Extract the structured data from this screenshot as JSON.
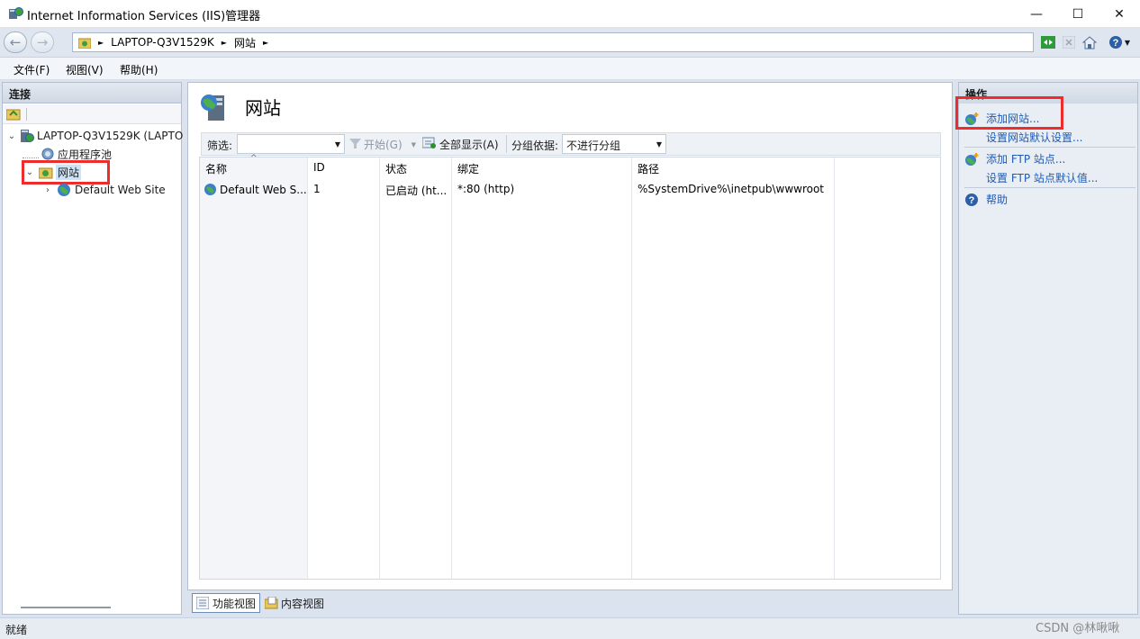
{
  "window": {
    "title": "Internet Information Services (IIS)管理器",
    "minimize_glyph": "—",
    "maximize_glyph": "☐",
    "close_glyph": "✕"
  },
  "address_bar": {
    "crumbs": [
      "LAPTOP-Q3V1529K",
      "网站"
    ],
    "crumb_separator": "►"
  },
  "menu": {
    "items": [
      "文件(F)",
      "视图(V)",
      "帮助(H)"
    ]
  },
  "connections": {
    "header": "连接",
    "tree": [
      {
        "label": "LAPTOP-Q3V1529K (LAPTO",
        "level": 0,
        "expanded": true,
        "icon": "server-icon"
      },
      {
        "label": "应用程序池",
        "level": 1,
        "icon": "app-pool-icon"
      },
      {
        "label": "网站",
        "level": 1,
        "expanded": true,
        "selected": true,
        "icon": "sites-folder-icon"
      },
      {
        "label": "Default Web Site",
        "level": 2,
        "expanded": false,
        "icon": "globe-icon"
      }
    ]
  },
  "center": {
    "title": "网站",
    "filter_label": "筛选:",
    "filter_value": "",
    "go_label": "开始(G)",
    "show_all_label": "全部显示(A)",
    "group_by_label": "分组依据:",
    "group_by_value": "不进行分组",
    "columns": [
      "名称",
      "ID",
      "状态",
      "绑定",
      "路径"
    ],
    "rows": [
      {
        "name": "Default Web S...",
        "id": "1",
        "status": "已启动 (ht...",
        "binding": "*:80 (http)",
        "path": "%SystemDrive%\\inetpub\\wwwroot"
      }
    ],
    "view_tabs": [
      "功能视图",
      "内容视图"
    ]
  },
  "actions": {
    "header": "操作",
    "groups": [
      {
        "items": [
          "添加网站...",
          "设置网站默认设置..."
        ]
      },
      {
        "items": [
          "添加 FTP 站点...",
          "设置 FTP 站点默认值..."
        ]
      },
      {
        "items": [
          "帮助"
        ]
      }
    ]
  },
  "status": {
    "text": "就绪",
    "watermark": "CSDN @林啾啾"
  },
  "colors": {
    "highlight": "#ef2c2c",
    "link": "#1f5bb3",
    "panel_bg": "#dbe3ee"
  }
}
